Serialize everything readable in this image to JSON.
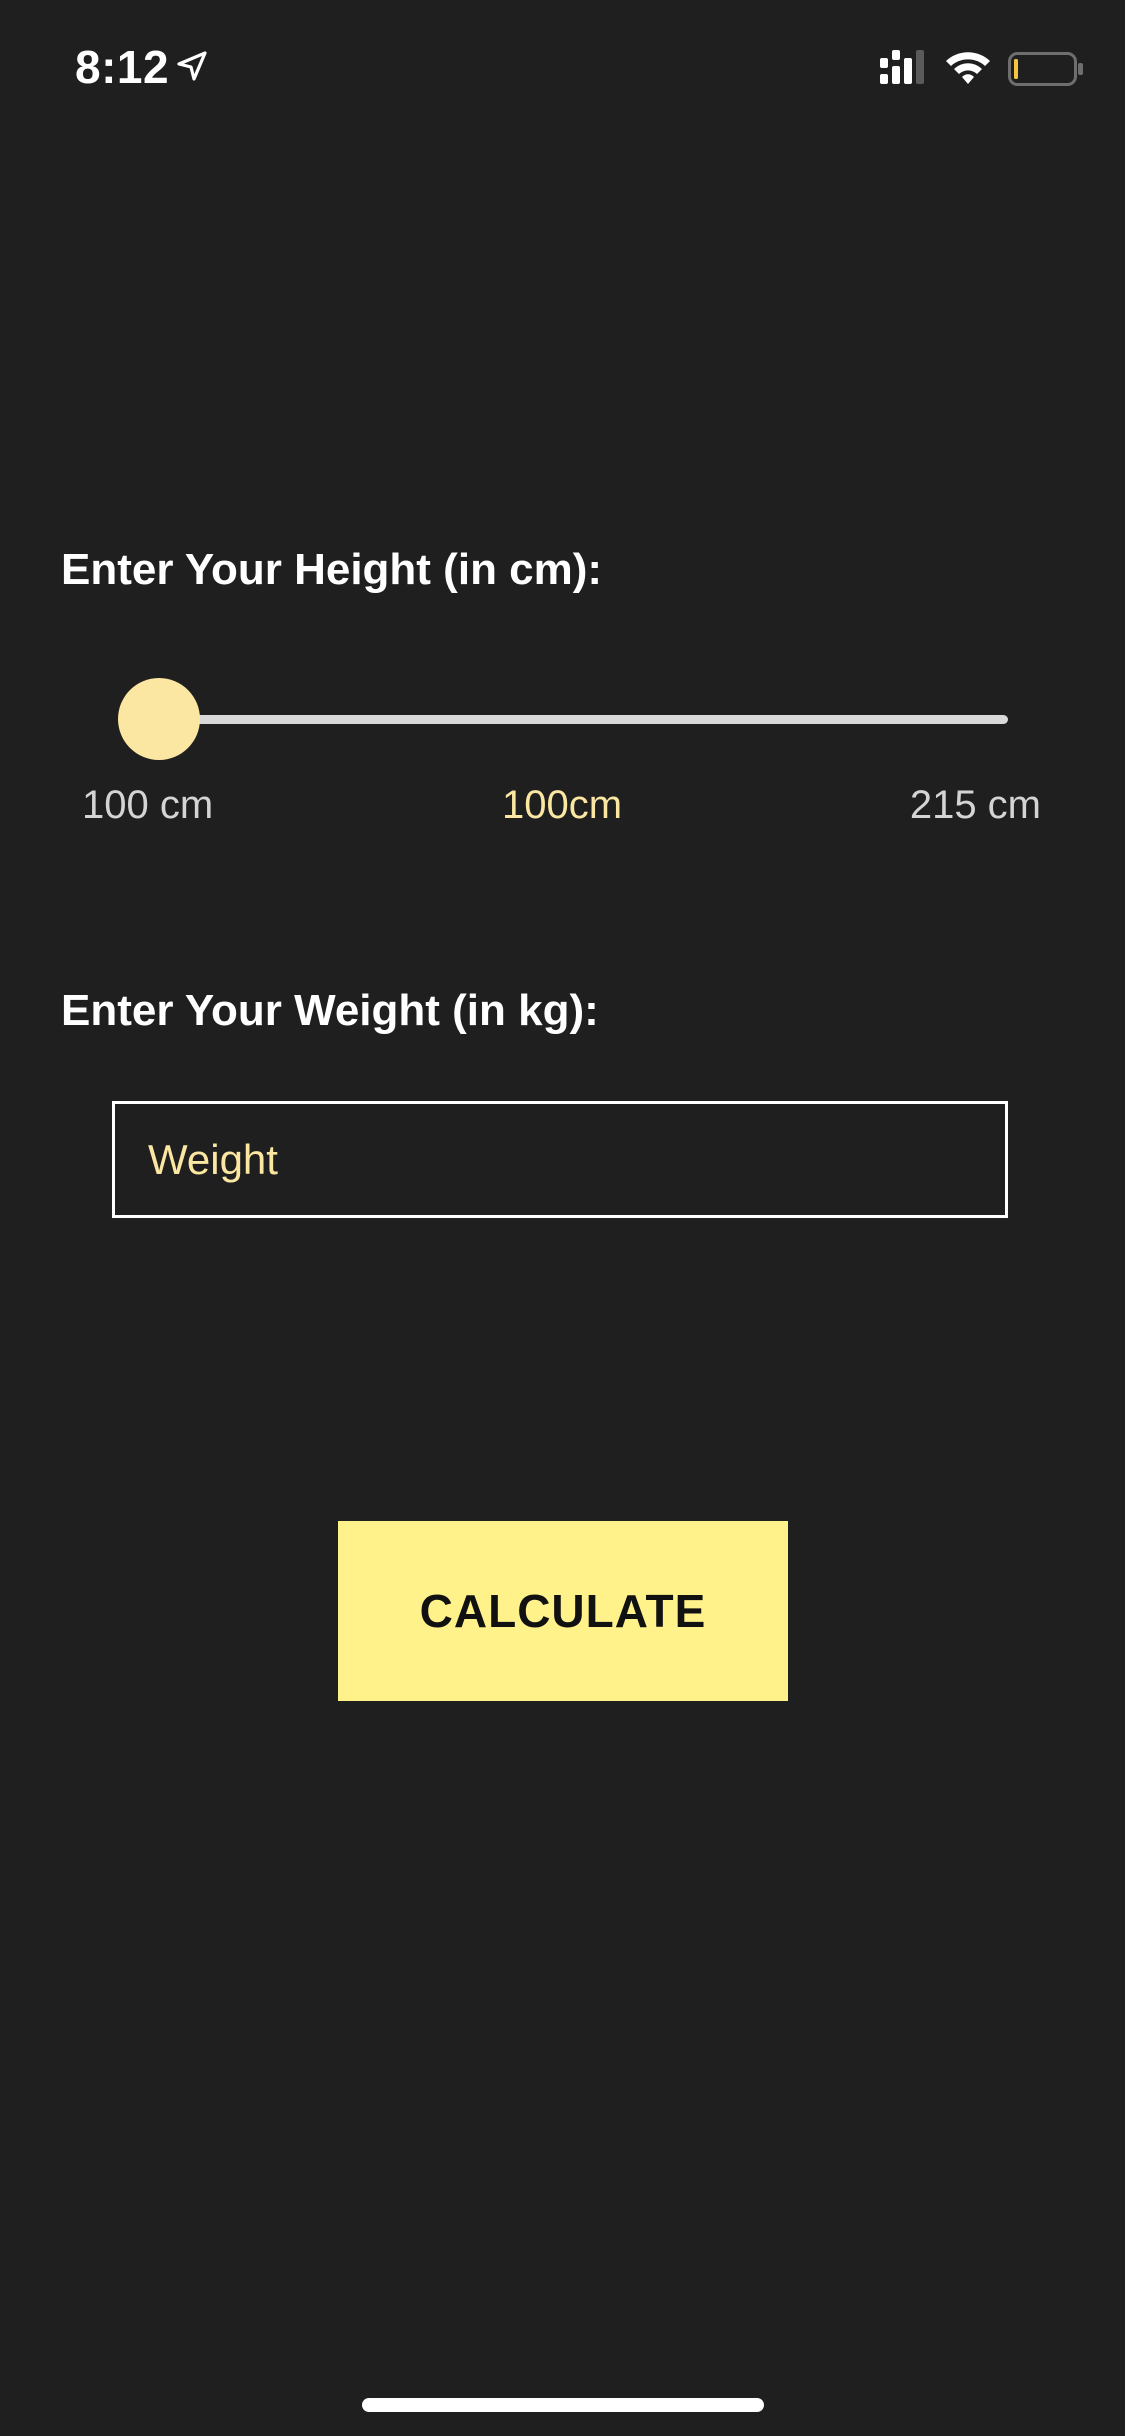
{
  "status_bar": {
    "time": "8:12",
    "icons": [
      "location-arrow-icon",
      "cellular-signal-icon",
      "wifi-icon",
      "battery-low-icon"
    ],
    "battery_level_fraction": 0.05
  },
  "height": {
    "label": "Enter Your Height (in cm):",
    "slider_value": 100,
    "slider_min": 100,
    "slider_max": 215,
    "min_label": "100 cm",
    "current_label": "100cm",
    "max_label": "215 cm"
  },
  "weight": {
    "label": "Enter Your Weight (in kg):",
    "placeholder": "Weight",
    "value": ""
  },
  "actions": {
    "calculate_label": "CALCULATE"
  },
  "colors": {
    "background": "#1f1f1f",
    "accent": "#fbe7a1",
    "button": "#fff28a"
  }
}
